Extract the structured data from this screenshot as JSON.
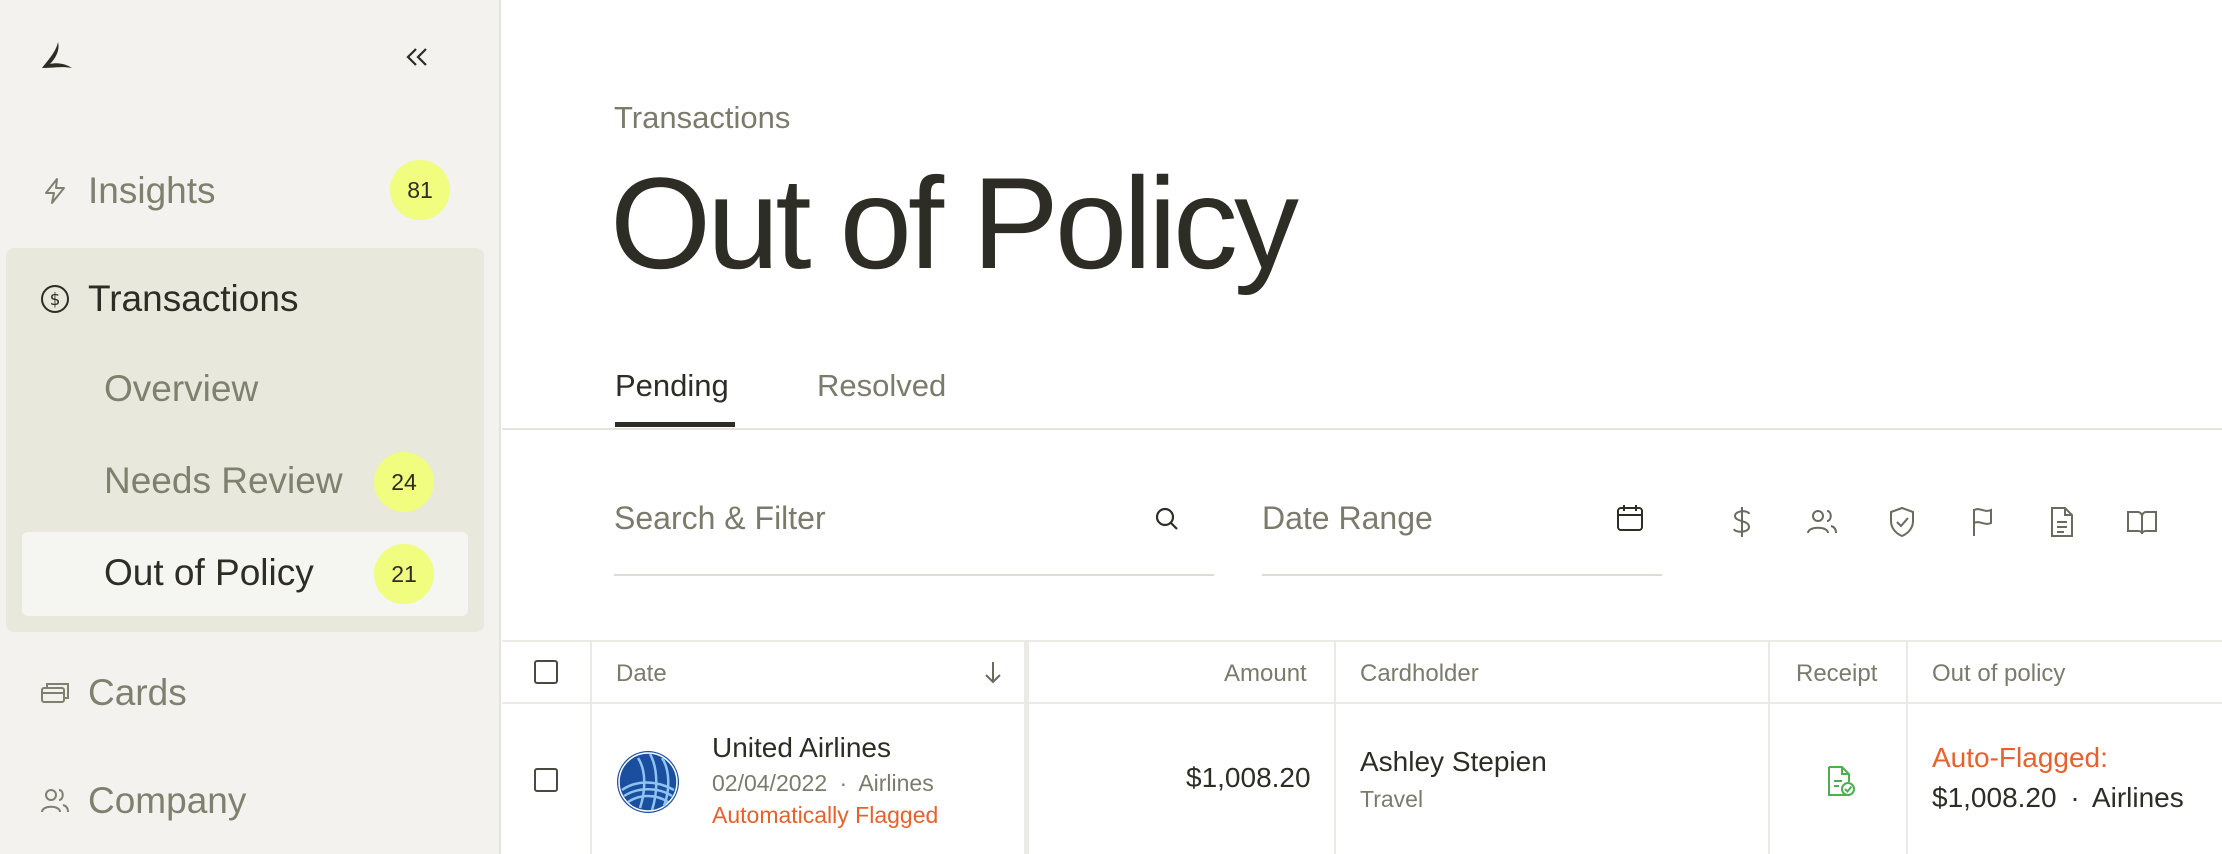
{
  "sidebar": {
    "logo_icon": "bird-logo-icon",
    "collapse_icon": "double-chevron-left-icon",
    "insights": {
      "label": "Insights",
      "badge": "81",
      "icon": "lightning-icon"
    },
    "transactions": {
      "label": "Transactions",
      "icon": "dollar-circle-icon",
      "items": [
        {
          "label": "Overview"
        },
        {
          "label": "Needs Review",
          "badge": "24"
        },
        {
          "label": "Out of Policy",
          "badge": "21"
        }
      ]
    },
    "cards": {
      "label": "Cards",
      "icon": "cards-icon"
    },
    "company": {
      "label": "Company",
      "icon": "people-icon"
    }
  },
  "header": {
    "breadcrumb": "Transactions",
    "title": "Out of Policy"
  },
  "tabs": [
    {
      "label": "Pending",
      "active": true
    },
    {
      "label": "Resolved",
      "active": false
    }
  ],
  "filters": {
    "search_placeholder": "Search & Filter",
    "date_placeholder": "Date Range",
    "toolbar_icons": [
      "dollar-icon",
      "people-icon",
      "shield-check-icon",
      "flag-icon",
      "document-icon",
      "book-icon"
    ]
  },
  "table": {
    "columns": [
      "Date",
      "Amount",
      "Cardholder",
      "Receipt",
      "Out of policy"
    ],
    "rows": [
      {
        "merchant": "United Airlines",
        "date": "02/04/2022",
        "separator": "·",
        "category": "Airlines",
        "flag_status": "Automatically Flagged",
        "amount": "$1,008.20",
        "cardholder": "Ashley Stepien",
        "department": "Travel",
        "receipt_icon": "receipt-check-icon",
        "oop_label": "Auto-Flagged:",
        "oop_amount": "$1,008.20",
        "oop_category": "Airlines"
      }
    ]
  },
  "colors": {
    "accent_badge": "#f0fd7e",
    "flag_orange": "#e8602c",
    "receipt_green": "#4caf50",
    "sidebar_bg": "#f3f2ee",
    "sidebar_group_bg": "#e8e8dc"
  }
}
